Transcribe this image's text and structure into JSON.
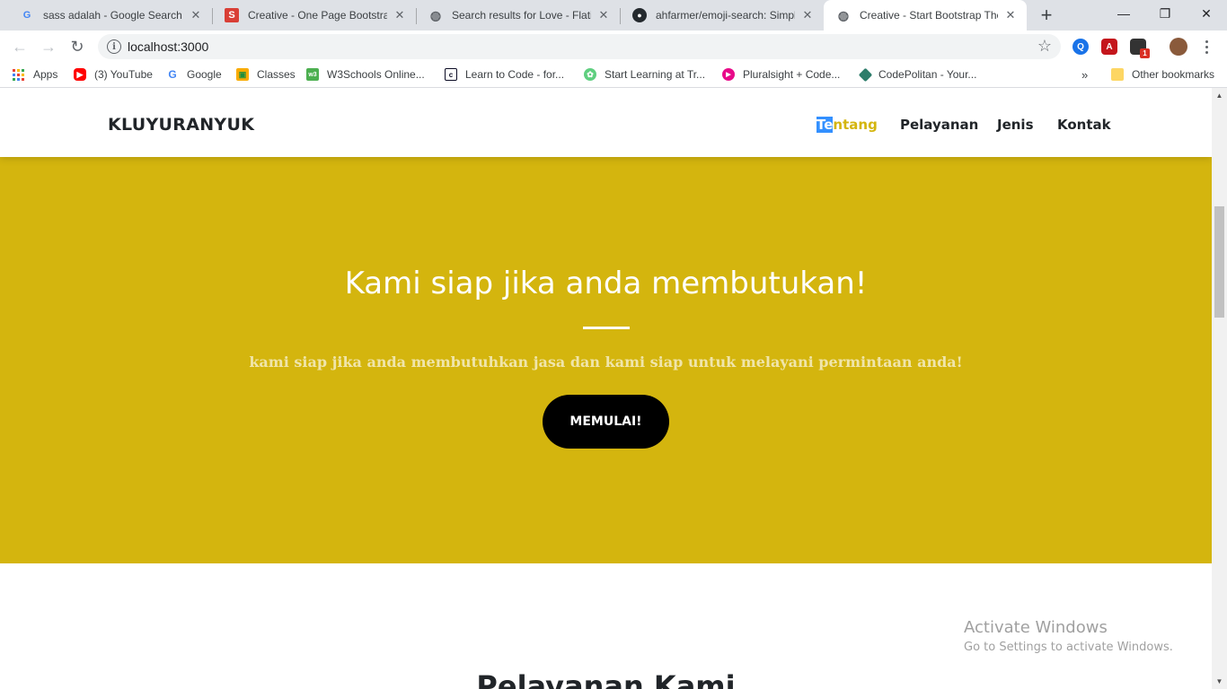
{
  "browser": {
    "tabs": [
      {
        "title": "sass adalah - Google Search",
        "icon": "google-icon"
      },
      {
        "title": "Creative - One Page Bootstrap",
        "icon": "s-icon"
      },
      {
        "title": "Search results for Love - Flaticon",
        "icon": "globe-icon"
      },
      {
        "title": "ahfarmer/emoji-search: Simple",
        "icon": "github-icon"
      },
      {
        "title": "Creative - Start Bootstrap Theme",
        "icon": "globe-icon",
        "active": true
      }
    ],
    "address": "localhost:3000",
    "bookmarks": [
      {
        "label": "Apps",
        "icon": "apps-icon"
      },
      {
        "label": "(3) YouTube",
        "icon": "youtube-icon"
      },
      {
        "label": "Google",
        "icon": "google-icon"
      },
      {
        "label": "Classes",
        "icon": "classes-icon"
      },
      {
        "label": "W3Schools Online...",
        "icon": "w3schools-icon"
      },
      {
        "label": "Learn to Code - for...",
        "icon": "freecodecamp-icon"
      },
      {
        "label": "Start Learning at Tr...",
        "icon": "treehouse-icon"
      },
      {
        "label": "Pluralsight + Code...",
        "icon": "pluralsight-icon"
      },
      {
        "label": "CodePolitan - Your...",
        "icon": "codepolitan-icon"
      }
    ],
    "overflow_label": "»",
    "other_bookmarks": "Other bookmarks",
    "extension_badge": "1"
  },
  "site": {
    "brand": "KLUYURANYUK",
    "nav": {
      "about_selected": "Te",
      "about_rest": "ntang",
      "services": "Pelayanan",
      "types": "Jenis",
      "contact": "Kontak"
    },
    "masthead": {
      "heading": "Kami siap jika anda membutukan!",
      "subtext": "kami siap jika anda membutuhkan jasa dan kami siap untuk melayani permintaan anda!",
      "button": "MEMULAI!"
    },
    "next_section_heading": "Pelayanan Kami"
  },
  "watermark": {
    "line1": "Activate Windows",
    "line2": "Go to Settings to activate Windows."
  },
  "colors": {
    "accent": "#d4b50e",
    "button": "#000000",
    "selection": "#3390ff"
  }
}
